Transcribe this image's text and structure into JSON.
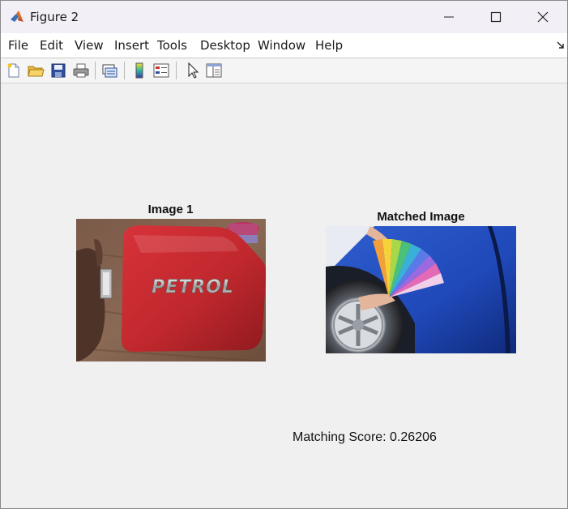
{
  "window": {
    "title": "Figure 2",
    "buttons": [
      "minimize",
      "maximize",
      "close"
    ]
  },
  "menu": {
    "items": [
      "File",
      "Edit",
      "View",
      "Insert",
      "Tools",
      "Desktop",
      "Window",
      "Help"
    ]
  },
  "toolbar": {
    "icons": [
      "new-figure-icon",
      "open-file-icon",
      "save-icon",
      "print-icon",
      "link-plot-icon",
      "colorbar-icon",
      "legend-icon",
      "pointer-icon",
      "property-inspector-icon"
    ]
  },
  "figure": {
    "image1": {
      "title": "Image 1",
      "overlay_text": "PETROL"
    },
    "image2": {
      "title": "Matched Image"
    },
    "score_text": "Matching Score: 0.26206"
  },
  "colors": {
    "titlebar": "#f3eff7",
    "figure_bg": "#f0f0f0",
    "red_panel": "#c0282d",
    "car_blue": "#1f48b8"
  }
}
